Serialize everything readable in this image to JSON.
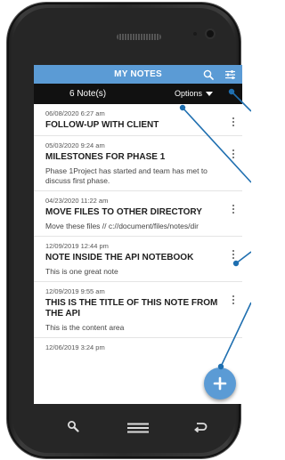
{
  "app": {
    "title": "MY NOTES",
    "accent_color": "#5b9bd5",
    "icons": [
      "search-icon",
      "filter-settings-icon"
    ]
  },
  "toolbar": {
    "note_count": "6 Note(s)",
    "options_label": "Options"
  },
  "notes": [
    {
      "date": "06/08/2020 6:27 am",
      "title": "FOLLOW-UP WITH CLIENT",
      "body": ""
    },
    {
      "date": "05/03/2020 9:24 am",
      "title": "MILESTONES FOR PHASE 1",
      "body": "Phase 1Project has started and team has met to discuss first phase."
    },
    {
      "date": "04/23/2020 11:22 am",
      "title": "MOVE FILES TO OTHER DIRECTORY",
      "body": "Move these files // c://document/files/notes/dir"
    },
    {
      "date": "12/09/2019 12:44 pm",
      "title": "NOTE INSIDE THE API NOTEBOOK",
      "body": "This is one great note"
    },
    {
      "date": "12/09/2019 9:55 am",
      "title": "THIS IS THE TITLE OF THIS NOTE FROM THE API",
      "body": "This is the content area"
    },
    {
      "date": "12/06/2019 3:24 pm",
      "title": "",
      "body": ""
    }
  ],
  "fab": {
    "icon": "plus-icon"
  },
  "device_nav": {
    "icons": [
      "search-icon",
      "menu-icon",
      "back-icon"
    ]
  }
}
